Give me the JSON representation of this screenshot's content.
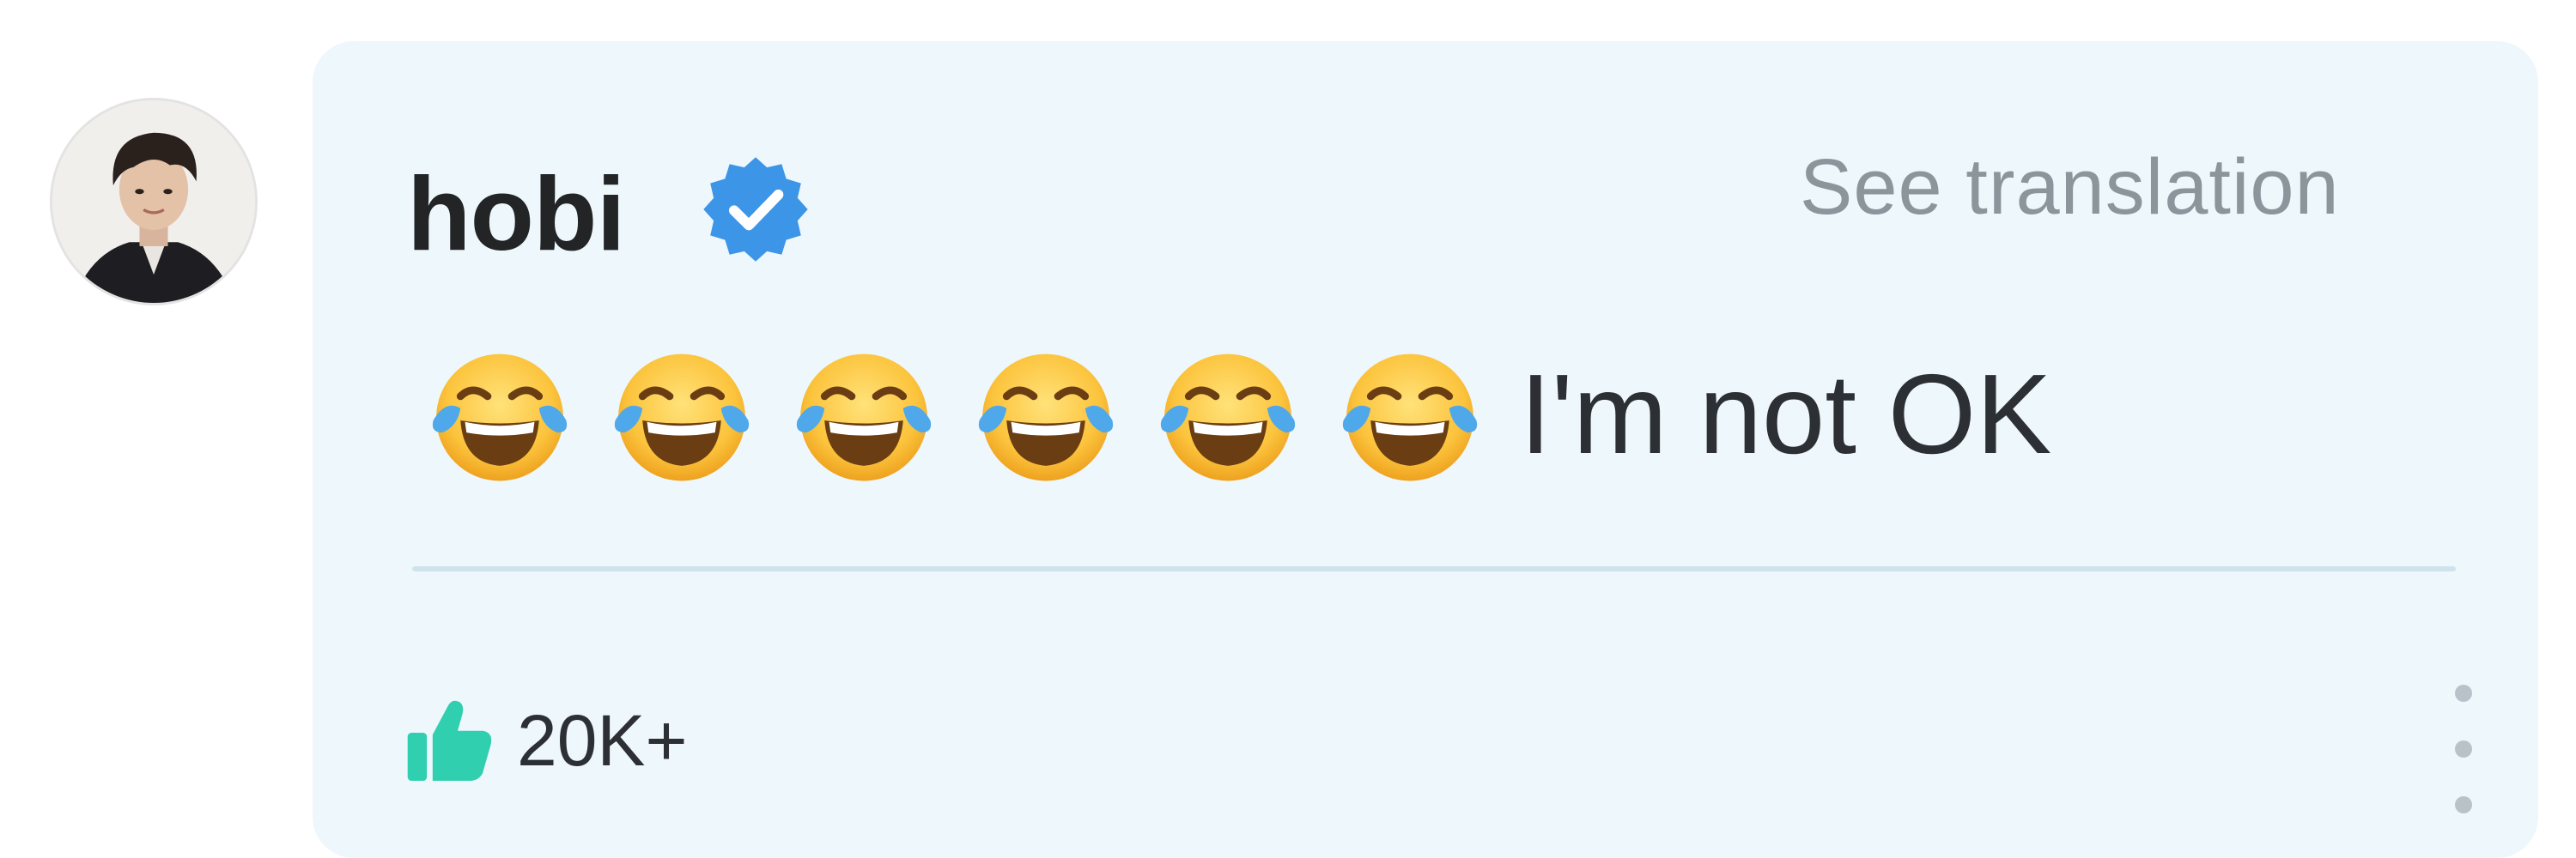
{
  "comment": {
    "author": {
      "name": "hobi",
      "verified": true,
      "avatar_icon": "user-avatar-photo"
    },
    "translate_link": "See translation",
    "body": {
      "emoji": [
        "😂",
        "😂",
        "😂",
        "😂",
        "😂",
        "😂"
      ],
      "emoji_name": "face-with-tears-of-joy",
      "text": "I'm not OK"
    },
    "footer": {
      "like_icon": "thumbs-up-icon",
      "like_count": "20K+",
      "more_icon": "vertical-ellipsis-icon"
    }
  },
  "colors": {
    "bubble_background": "#eef7fc",
    "verified_badge": "#3d95e8",
    "like_icon": "#2fcfb0",
    "secondary_text": "#8c959c",
    "primary_text": "#222426"
  }
}
